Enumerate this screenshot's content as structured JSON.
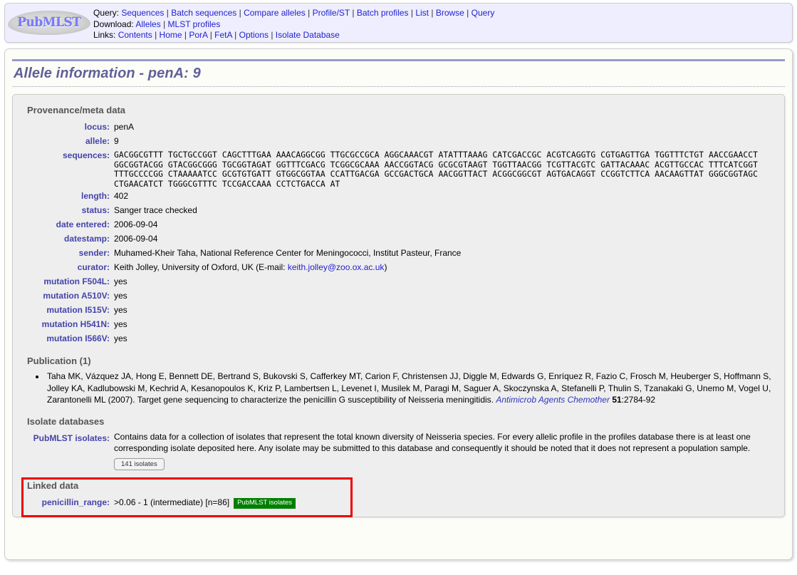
{
  "header": {
    "logo_text": "PubMLST",
    "rows": [
      {
        "label": "Query:",
        "links": [
          "Sequences",
          "Batch sequences",
          "Compare alleles",
          "Profile/ST",
          "Batch profiles",
          "List",
          "Browse",
          "Query"
        ]
      },
      {
        "label": "Download:",
        "links": [
          "Alleles",
          "MLST profiles"
        ]
      },
      {
        "label": "Links:",
        "links": [
          "Contents",
          "Home",
          "PorA",
          "FetA",
          "Options",
          "Isolate Database"
        ]
      }
    ]
  },
  "page": {
    "title": "Allele information - penA: 9"
  },
  "provenance": {
    "heading": "Provenance/meta data",
    "fields": [
      {
        "label": "locus:",
        "value": "penA"
      },
      {
        "label": "allele:",
        "value": "9"
      }
    ],
    "sequence_label": "sequences:",
    "sequence_lines": [
      "GACGGCGTTT TGCTGCCGGT CAGCTTTGAA AAACAGGCGG TTGCGCCGCA AGGCAAACGT ATATTTAAAG CATCGACCGC ACGTCAGGTG CGTGAGTTGA TGGTTTCTGT AACCGAACCT",
      "GGCGGTACGG GTACGGCGGG TGCGGTAGAT GGTTTCGACG TCGGCGCAAA AACCGGTACG GCGCGTAAGT TGGTTAACGG TCGTTACGTC GATTACAAAC ACGTTGCCAC TTTCATCGGT",
      "TTTGCCCCGG CTAAAAATCC GCGTGTGATT GTGGCGGTAA CCATTGACGA GCCGACTGCA AACGGTTACT ACGGCGGCGT AGTGACAGGT CCGGTCTTCA AACAAGTTAT GGGCGGTAGC",
      "CTGAACATCT TGGGCGTTTC TCCGACCAAA CCTCTGACCA AT"
    ],
    "more_fields": [
      {
        "label": "length:",
        "value": "402"
      },
      {
        "label": "status:",
        "value": "Sanger trace checked"
      },
      {
        "label": "date entered:",
        "value": "2006-09-04"
      },
      {
        "label": "datestamp:",
        "value": "2006-09-04"
      },
      {
        "label": "sender:",
        "value": "Muhamed-Kheir Taha, National Reference Center for Meningococci, Institut Pasteur, France"
      }
    ],
    "curator": {
      "label": "curator:",
      "prefix": "Keith Jolley, University of Oxford, UK (E-mail: ",
      "email": "keith.jolley@zoo.ox.ac.uk",
      "suffix": ")"
    },
    "mutations": [
      {
        "label": "mutation F504L:",
        "value": "yes"
      },
      {
        "label": "mutation A510V:",
        "value": "yes"
      },
      {
        "label": "mutation I515V:",
        "value": "yes"
      },
      {
        "label": "mutation H541N:",
        "value": "yes"
      },
      {
        "label": "mutation I566V:",
        "value": "yes"
      }
    ]
  },
  "publication": {
    "heading": "Publication (1)",
    "authors_and_title": "Taha MK, Vázquez JA, Hong E, Bennett DE, Bertrand S, Bukovski S, Cafferkey MT, Carion F, Christensen JJ, Diggle M, Edwards G, Enríquez R, Fazio C, Frosch M, Heuberger S, Hoffmann S, Jolley KA, Kadlubowski M, Kechrid A, Kesanopoulos K, Kriz P, Lambertsen L, Levenet I, Musilek M, Paragi M, Saguer A, Skoczynska A, Stefanelli P, Thulin S, Tzanakaki G, Unemo M, Vogel U, Zarantonelli ML (2007). Target gene sequencing to characterize the penicillin G susceptibility of Neisseria meningitidis. ",
    "journal": "Antimicrob Agents Chemother",
    "volume": "51",
    "pages": ":2784-92"
  },
  "isolate_databases": {
    "heading": "Isolate databases",
    "label": "PubMLST isolates:",
    "description": "Contains data for a collection of isolates that represent the total known diversity of Neisseria species. For every allelic profile in the profiles database there is at least one corresponding isolate deposited here. Any isolate may be submitted to this database and consequently it should be noted that it does not represent a population sample.",
    "button_label": "141 isolates"
  },
  "linked_data": {
    "heading": "Linked data",
    "label": "penicillin_range:",
    "value": ">0.06 - 1 (intermediate) [n=86]",
    "badge": "PubMLST isolates",
    "badge_color": "#008000",
    "highlight_color": "#ee0000"
  }
}
